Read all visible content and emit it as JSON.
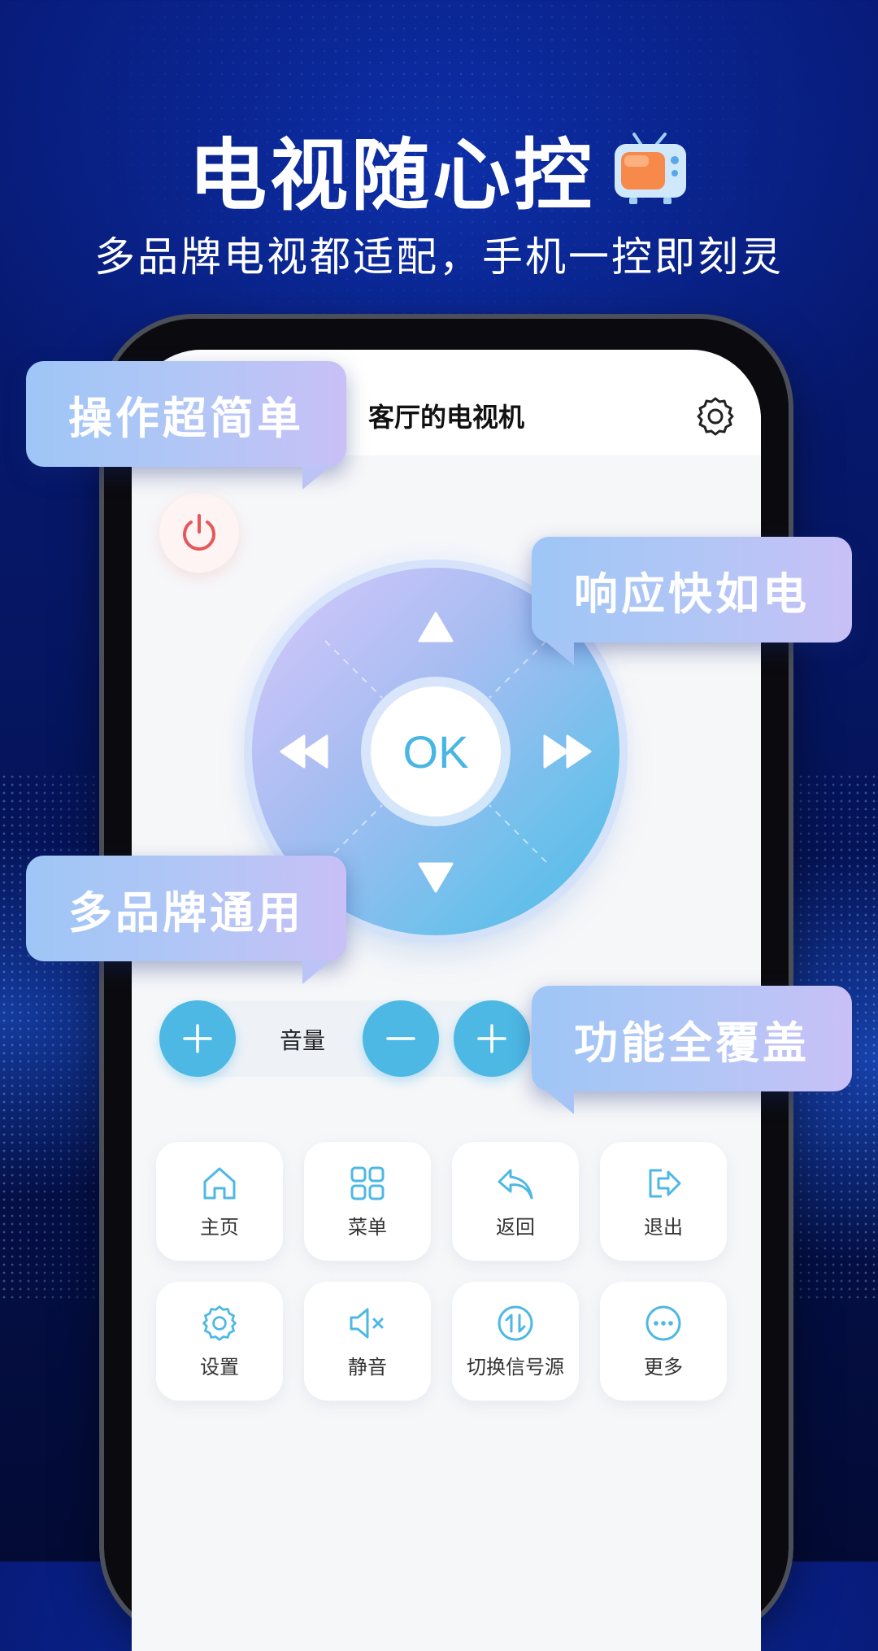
{
  "header": {
    "title": "电视随心控",
    "subtitle": "多品牌电视都适配，手机一控即刻灵"
  },
  "app": {
    "device_name": "客厅的电视机",
    "ok_label": "OK",
    "volume_label": "音量",
    "grid": [
      {
        "label": "主页",
        "icon": "home-icon"
      },
      {
        "label": "菜单",
        "icon": "menu-grid-icon"
      },
      {
        "label": "返回",
        "icon": "back-icon"
      },
      {
        "label": "退出",
        "icon": "exit-icon"
      },
      {
        "label": "设置",
        "icon": "gear-icon"
      },
      {
        "label": "静音",
        "icon": "mute-icon"
      },
      {
        "label": "切换信号源",
        "icon": "switch-source-icon"
      },
      {
        "label": "更多",
        "icon": "more-icon"
      }
    ]
  },
  "callouts": [
    "操作超简单",
    "响应快如电",
    "多品牌通用",
    "功能全覆盖"
  ],
  "colors": {
    "accent": "#4db8e4",
    "power": "#e5585a",
    "background": "#061767"
  }
}
